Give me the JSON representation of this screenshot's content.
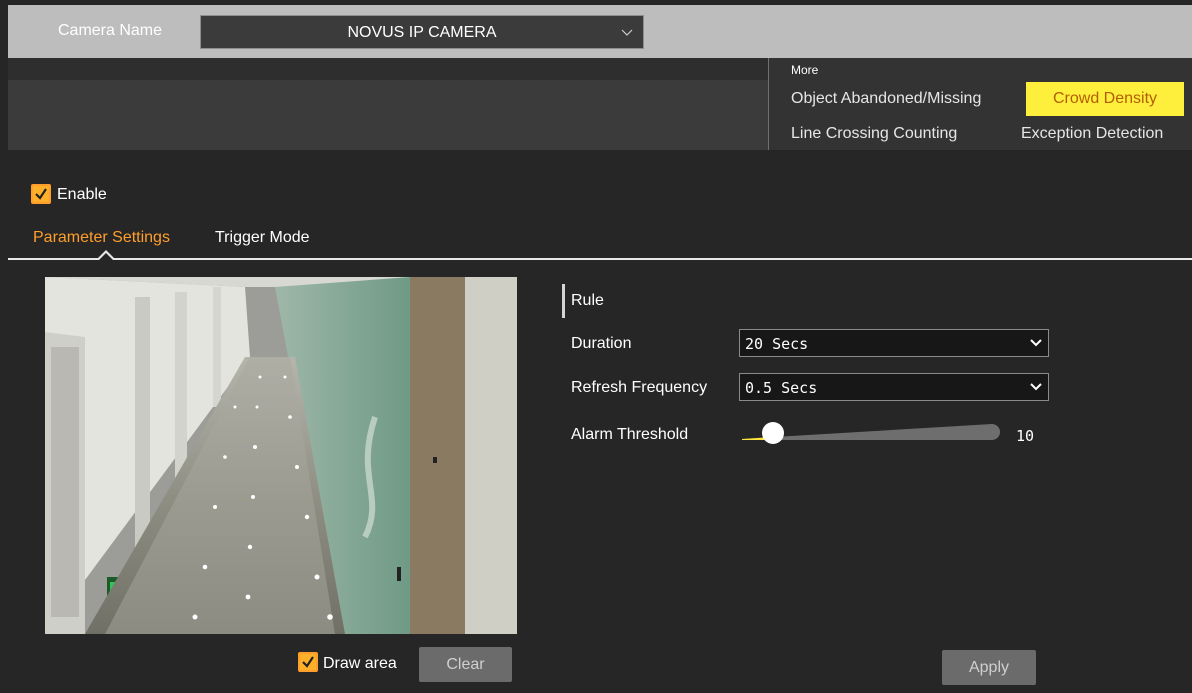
{
  "header": {
    "camera_name_label": "Camera Name",
    "camera_name_value": "NOVUS IP CAMERA"
  },
  "more_menu": {
    "label": "More",
    "items": [
      {
        "label": "Object Abandoned/Missing",
        "active": false
      },
      {
        "label": "Crowd Density",
        "active": true
      },
      {
        "label": "Line Crossing Counting",
        "active": false
      },
      {
        "label": "Exception Detection",
        "active": false
      }
    ]
  },
  "enable": {
    "label": "Enable",
    "checked": true
  },
  "tabs": [
    {
      "label": "Parameter Settings",
      "active": true
    },
    {
      "label": "Trigger Mode",
      "active": false
    }
  ],
  "preview": {
    "draw_area_label": "Draw area",
    "draw_area_checked": true,
    "clear_label": "Clear"
  },
  "rule": {
    "title": "Rule",
    "duration_label": "Duration",
    "duration_value": "20 Secs",
    "refresh_label": "Refresh Frequency",
    "refresh_value": "0.5 Secs",
    "alarm_label": "Alarm Threshold",
    "alarm_value": "10"
  },
  "apply_label": "Apply",
  "colors": {
    "accent": "#ff9e2a",
    "active_menu_bg": "#ffef3d",
    "slider_fill": "#ffe53a"
  }
}
